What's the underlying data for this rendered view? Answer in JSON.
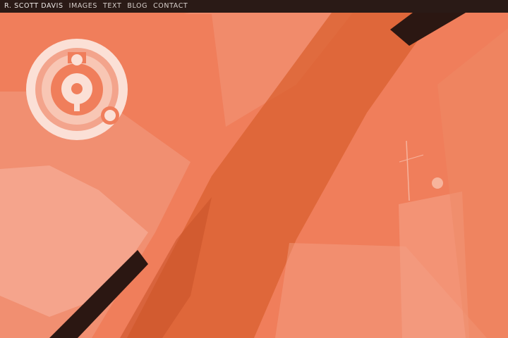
{
  "nav": {
    "brand": "R. SCOTT DAVIS",
    "items": [
      {
        "label": "IMAGES",
        "name": "nav-images"
      },
      {
        "label": "TEXT",
        "name": "nav-text"
      },
      {
        "label": "BLOG",
        "name": "nav-blog"
      },
      {
        "label": "CONTACT",
        "name": "nav-contact"
      }
    ]
  },
  "colors": {
    "background": "#ef7d58",
    "nav_bar": "#2a1a16",
    "nav_text": "#d7cfcb",
    "logo_light": "#fbe0d6",
    "dark_band": "#2b1712"
  },
  "logo": {
    "icon": "circular-monogram-logo-icon"
  },
  "background_image": {
    "icon": "architectural-photo-orange-tint"
  }
}
